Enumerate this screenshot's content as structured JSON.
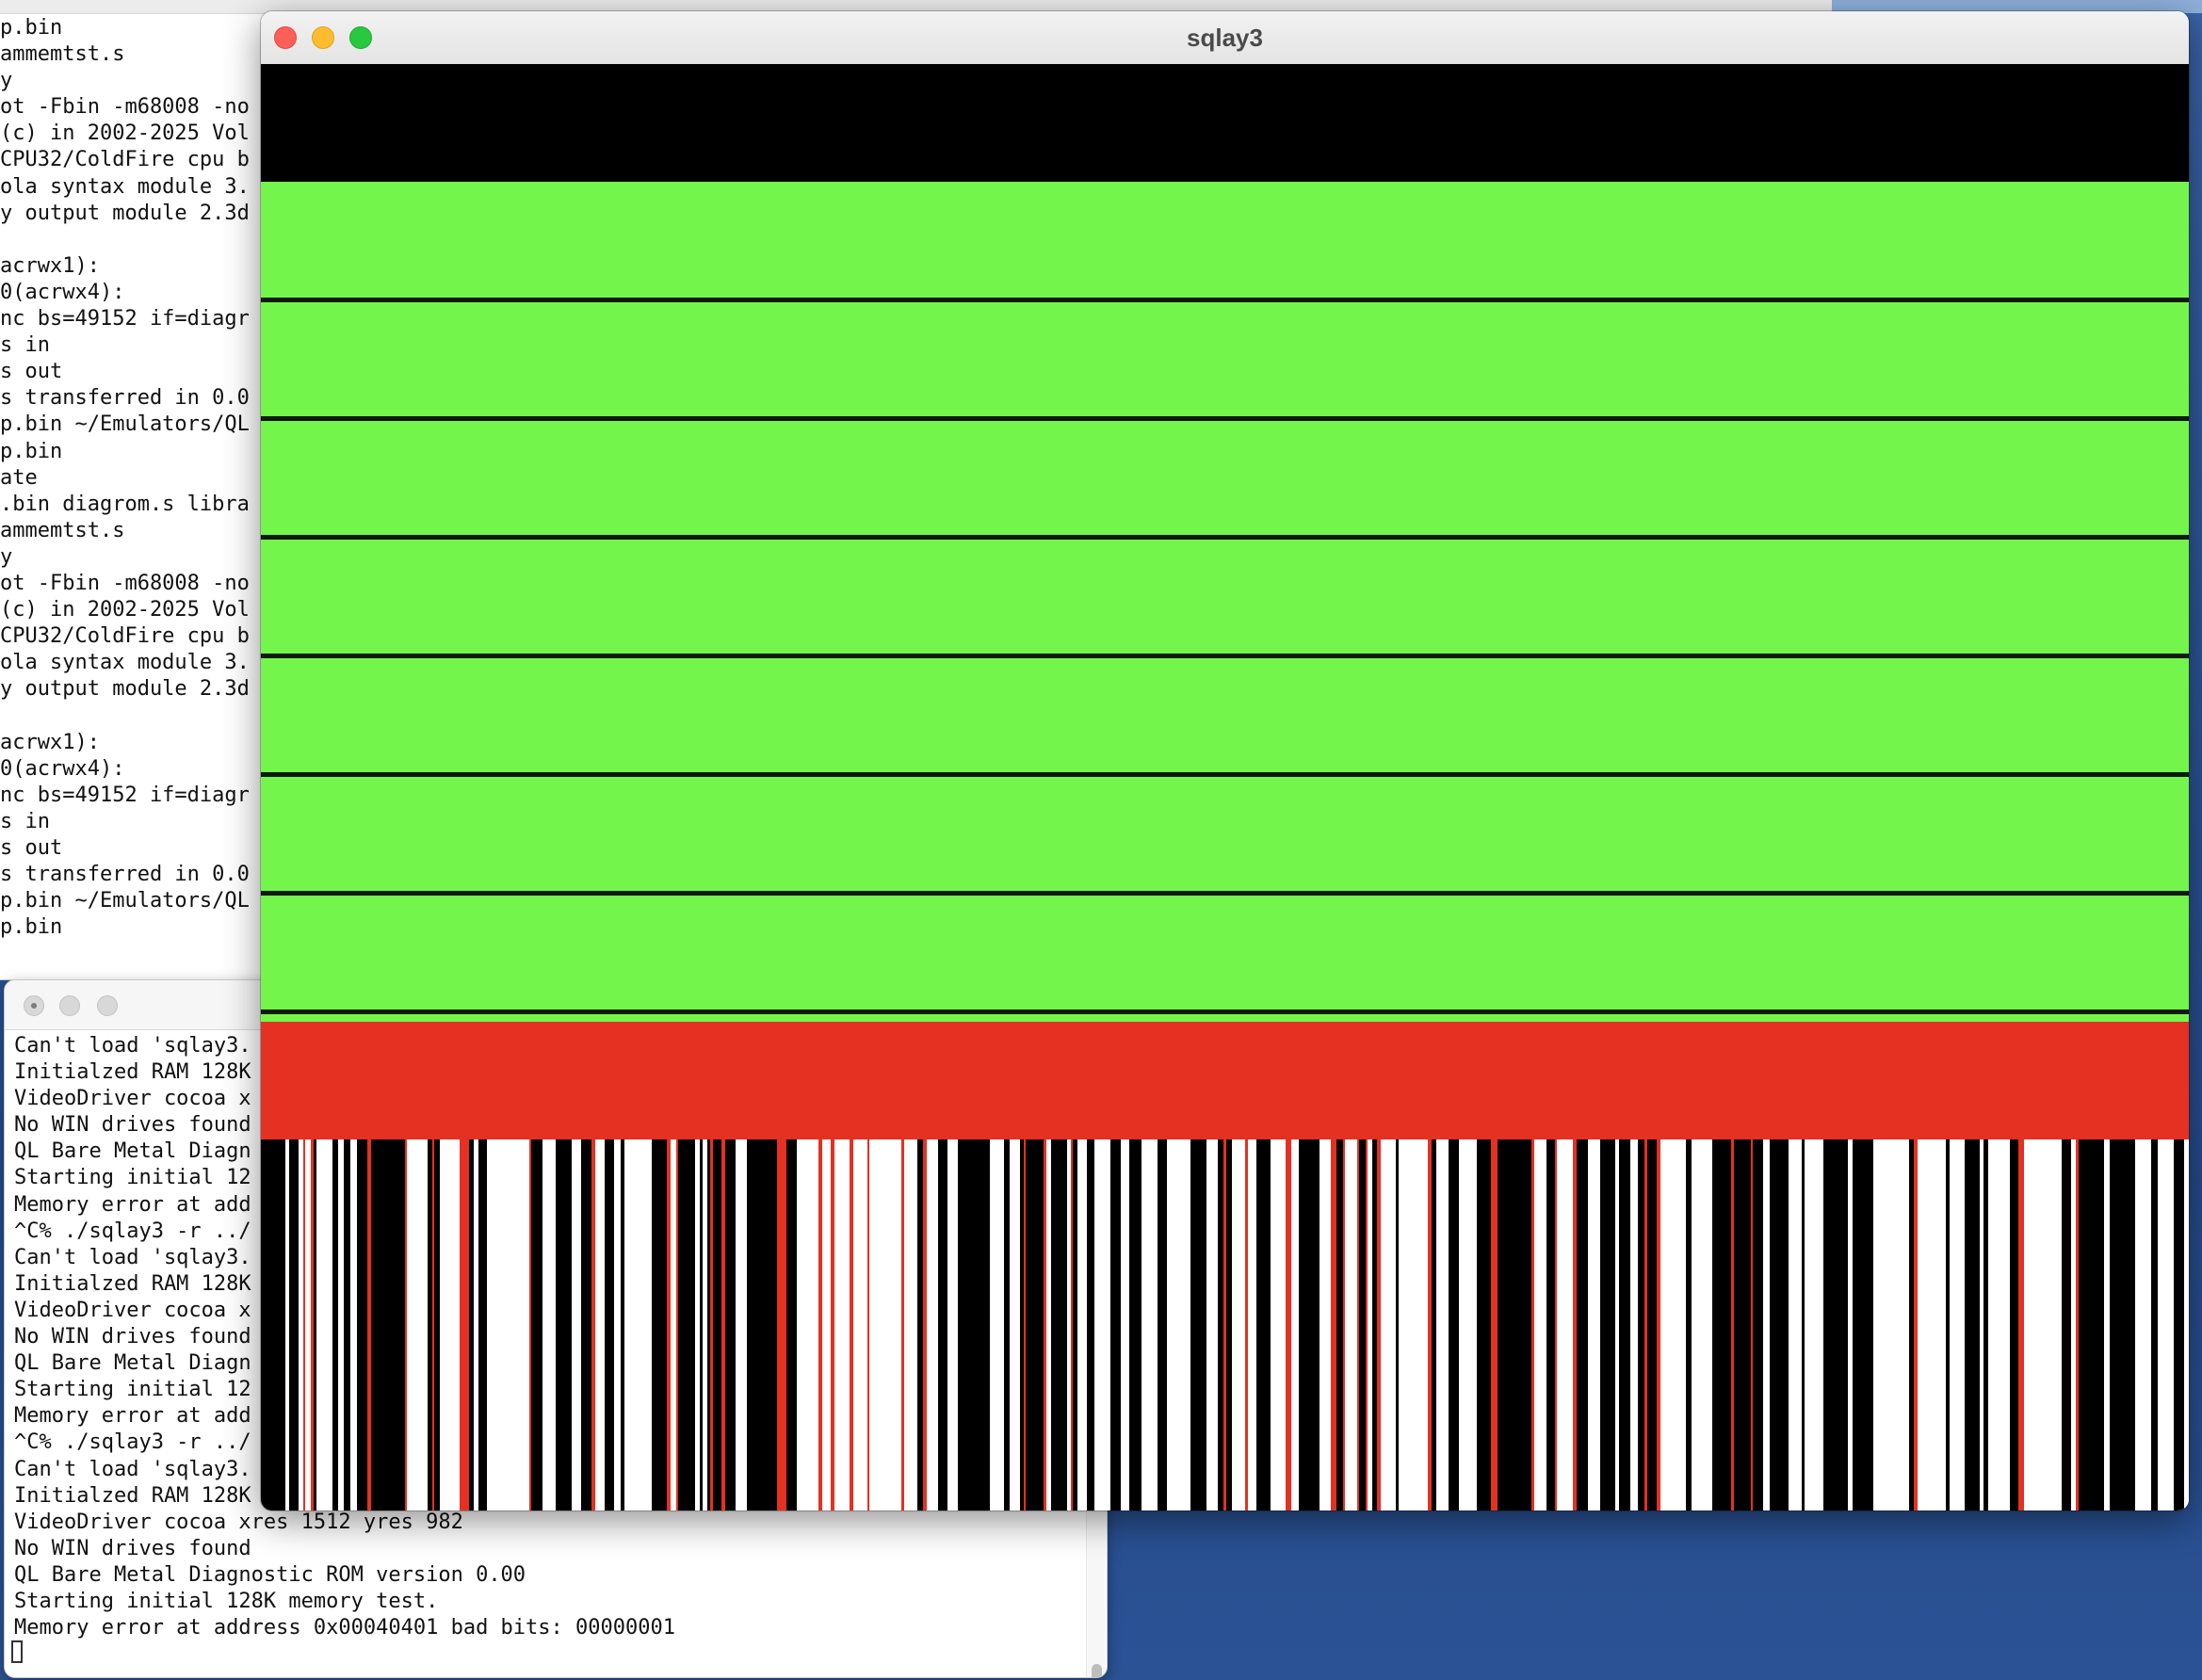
{
  "emulator_window": {
    "title": "sqlay3",
    "colors": {
      "black": "#000000",
      "green": "#74f54b",
      "red": "#e43122",
      "white": "#ffffff"
    }
  },
  "back_terminal": {
    "lines": [
      "p.bin",
      "ammemtst.s",
      "y",
      "ot -Fbin -m68008 -no",
      "(c) in 2002-2025 Vol",
      "CPU32/ColdFire cpu b",
      "ola syntax module 3.",
      "y output module 2.3d",
      "",
      "acrwx1):",
      "0(acrwx4):",
      "nc bs=49152 if=diagr",
      "s in",
      "s out",
      "s transferred in 0.0",
      "p.bin ~/Emulators/QL",
      "p.bin",
      "ate",
      ".bin diagrom.s libra",
      "ammemtst.s",
      "y",
      "ot -Fbin -m68008 -no",
      "(c) in 2002-2025 Vol",
      "CPU32/ColdFire cpu b",
      "ola syntax module 3.",
      "y output module 2.3d",
      "",
      "acrwx1):",
      "0(acrwx4):",
      "nc bs=49152 if=diagr",
      "s in",
      "s out",
      "s transferred in 0.0",
      "p.bin ~/Emulators/QL",
      "p.bin"
    ]
  },
  "front_terminal": {
    "lines": [
      "Can't load 'sqlay3.",
      "Initialzed RAM 128K",
      "VideoDriver cocoa x",
      "No WIN drives found",
      "QL Bare Metal Diagn",
      "Starting initial 12",
      "Memory error at add",
      "^C% ./sqlay3 -r ../",
      "Can't load 'sqlay3.",
      "Initialzed RAM 128K",
      "VideoDriver cocoa x",
      "No WIN drives found",
      "QL Bare Metal Diagn",
      "Starting initial 12",
      "Memory error at add",
      "^C% ./sqlay3 -r ../",
      "Can't load 'sqlay3.",
      "Initialzed RAM 128K",
      "VideoDriver cocoa xres 1512 yres 982",
      "No WIN drives found",
      "QL Bare Metal Diagnostic ROM version 0.00",
      "Starting initial 128K memory test.",
      "Memory error at address 0x00040401 bad bits: 00000001"
    ]
  }
}
